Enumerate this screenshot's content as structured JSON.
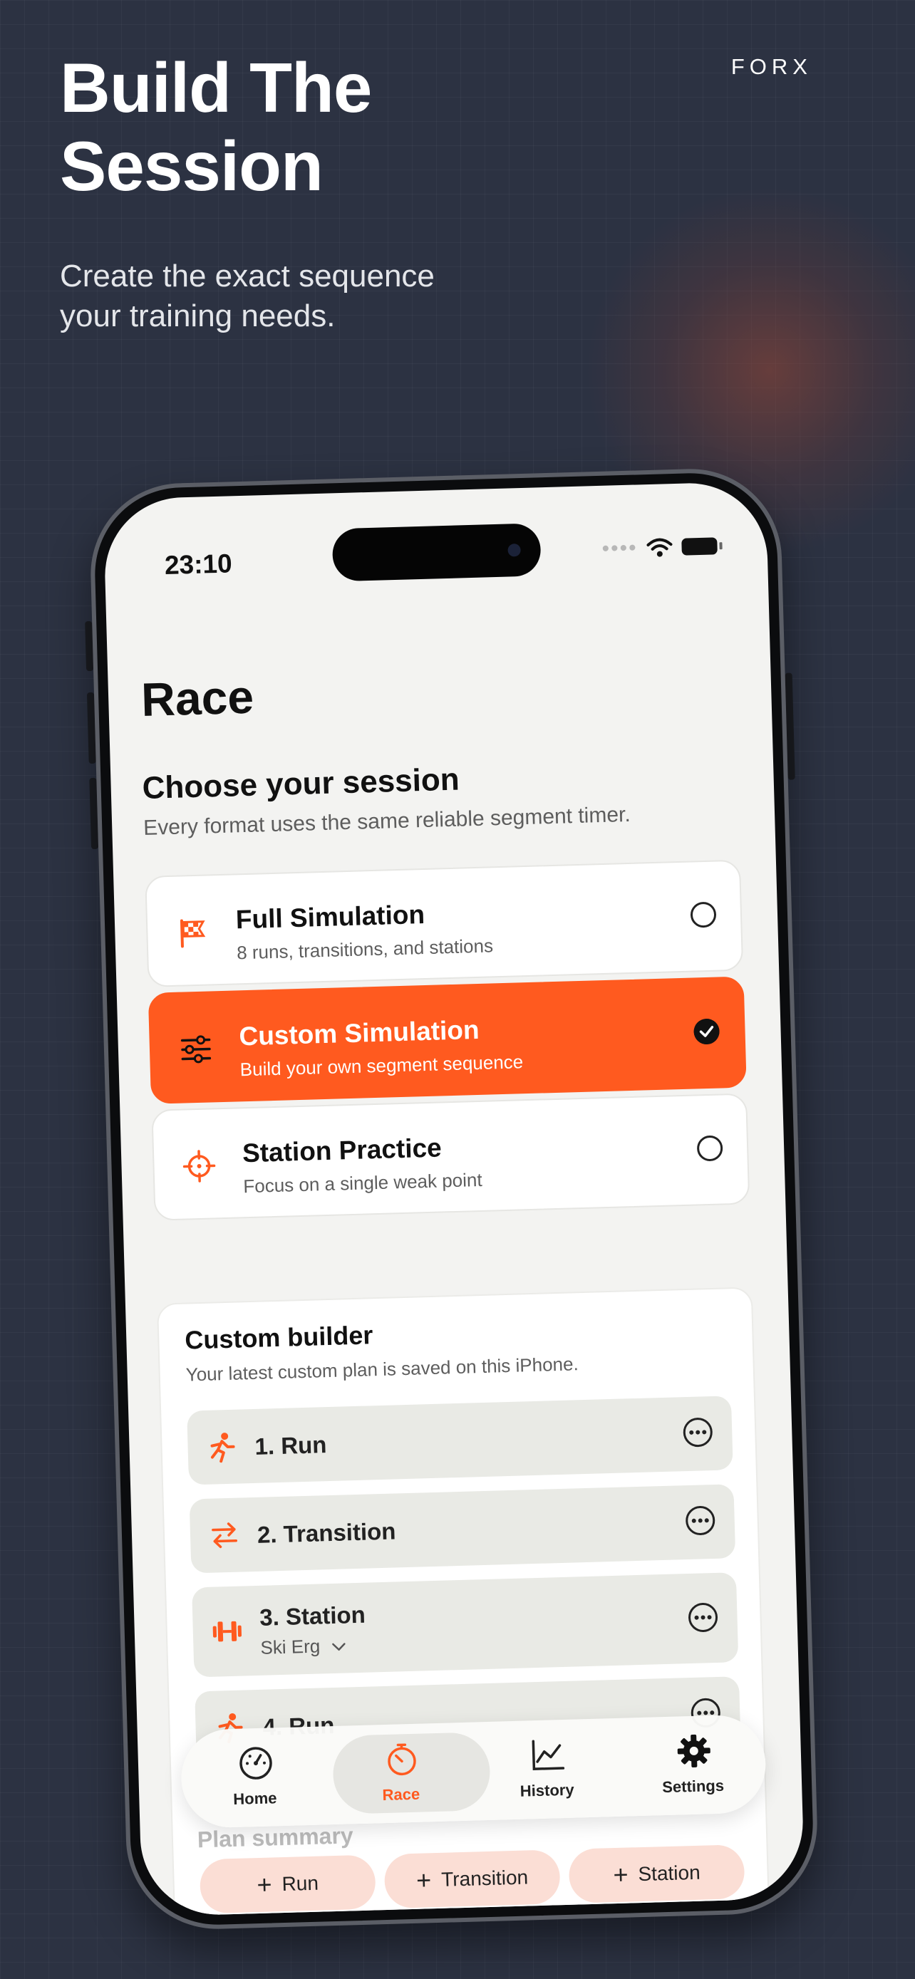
{
  "hero": {
    "headline_line1": "Build The",
    "headline_line2": "Session",
    "brand": "FORX",
    "subhead": "Create the exact sequence your training needs."
  },
  "status_bar": {
    "time": "23:10"
  },
  "page": {
    "title": "Race",
    "section_title": "Choose your session",
    "section_subtitle": "Every format uses the same reliable segment timer."
  },
  "options": [
    {
      "title": "Full Simulation",
      "desc": "8 runs, transitions, and stations",
      "icon": "checkered-flag-icon",
      "selected": false
    },
    {
      "title": "Custom Simulation",
      "desc": "Build your own segment sequence",
      "icon": "sliders-icon",
      "selected": true
    },
    {
      "title": "Station Practice",
      "desc": "Focus on a single weak point",
      "icon": "crosshair-icon",
      "selected": false
    }
  ],
  "builder": {
    "title": "Custom builder",
    "subtitle": "Your latest custom plan is saved on this iPhone.",
    "segments": [
      {
        "label": "1. Run",
        "icon": "runner-icon"
      },
      {
        "label": "2. Transition",
        "icon": "swap-arrows-icon"
      },
      {
        "label": "3. Station",
        "sub": "Ski Erg",
        "icon": "dumbbell-icon"
      },
      {
        "label": "4. Run",
        "icon": "runner-icon"
      }
    ],
    "add_buttons": [
      "Run",
      "Transition",
      "Station"
    ],
    "plan_summary": "Plan summary"
  },
  "tabs": [
    {
      "label": "Home",
      "icon": "gauge-icon",
      "active": false
    },
    {
      "label": "Race",
      "icon": "stopwatch-icon",
      "active": true
    },
    {
      "label": "History",
      "icon": "chart-icon",
      "active": false
    },
    {
      "label": "Settings",
      "icon": "gear-icon",
      "active": false
    }
  ],
  "colors": {
    "accent": "#ff5a1f",
    "background": "#2c3242",
    "screen": "#f3f3f1"
  }
}
